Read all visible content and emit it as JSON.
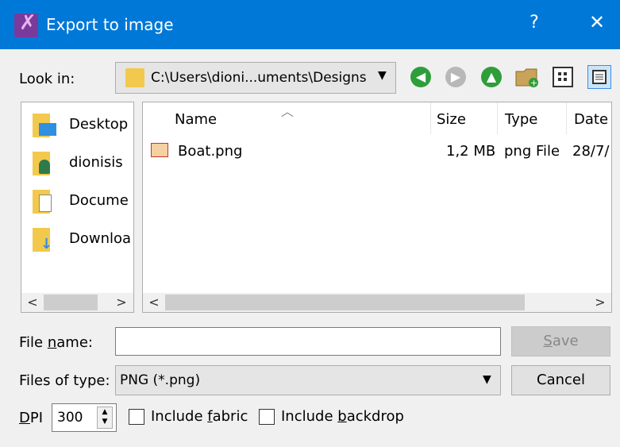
{
  "window": {
    "title": "Export to image",
    "help_label": "?",
    "close_label": "✕"
  },
  "lookin": {
    "label": "Look in:",
    "path": "C:\\Users\\dioni...uments\\Designs",
    "arrow": "▼"
  },
  "toolbar": {
    "back_glyph": "◀",
    "forward_glyph": "▶",
    "up_glyph": "▲"
  },
  "sidebar": {
    "items": [
      {
        "label": "Desktop",
        "icon": "desktop-icon"
      },
      {
        "label": "dionisis",
        "icon": "user-folder-icon"
      },
      {
        "label": "Docume",
        "icon": "documents-icon"
      },
      {
        "label": "Downloa",
        "icon": "downloads-icon"
      }
    ]
  },
  "filelist": {
    "columns": [
      "Name",
      "Size",
      "Type",
      "Date"
    ],
    "rows": [
      {
        "name": "Boat.png",
        "size": "1,2 MB",
        "type": "png File",
        "date": "28/7/"
      }
    ]
  },
  "scroll": {
    "left": "<",
    "right": ">"
  },
  "filename": {
    "label_pre": "File ",
    "label_u": "n",
    "label_post": "ame:",
    "value": ""
  },
  "save": {
    "label_u": "S",
    "label_rest": "ave"
  },
  "filetype": {
    "label": "Files of type:",
    "value": "PNG (*.png)",
    "arrow": "▼"
  },
  "cancel": {
    "label": "Cancel"
  },
  "dpi": {
    "label_u": "D",
    "label_rest": "PI",
    "value": "300"
  },
  "options": {
    "fabric_pre": "Include ",
    "fabric_u": "f",
    "fabric_post": "abric",
    "backdrop_pre": "Include ",
    "backdrop_u": "b",
    "backdrop_post": "ackdrop"
  },
  "colors": {
    "titlebar": "#0078d7",
    "back_icon": "#2e9e3a",
    "folder": "#f2c94c"
  }
}
